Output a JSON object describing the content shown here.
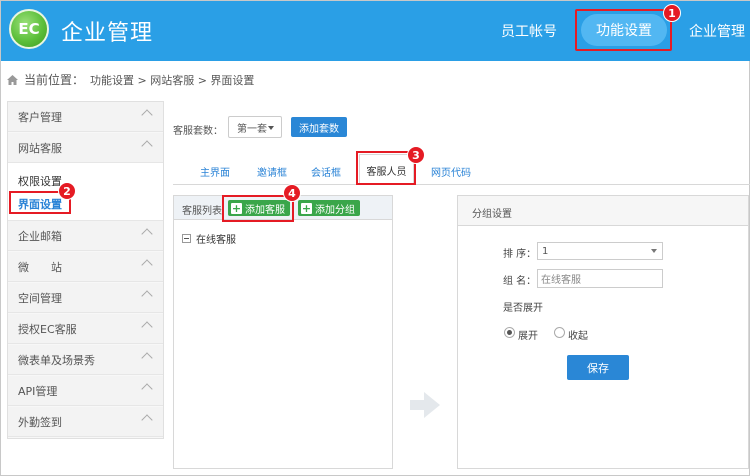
{
  "header": {
    "logo_text": "EC",
    "title": "企业管理",
    "nav": {
      "staff": "员工帐号",
      "function_settings": "功能设置",
      "enterprise": "企业管理"
    }
  },
  "breadcrumb": {
    "current_label": "当前位置：",
    "path": "功能设置 > 网站客服 > 界面设置"
  },
  "sidebar": {
    "items": [
      "客户管理",
      "网站客服",
      "企业邮箱",
      "微　　站",
      "空间管理",
      "授权EC客服",
      "微表单及场景秀",
      "API管理",
      "外勤签到"
    ],
    "sub_items": [
      "权限设置",
      "界面设置"
    ]
  },
  "toolbar": {
    "set_label": "客服套数：",
    "set_value": "第一套",
    "add_set_button": "添加套数"
  },
  "tabs": [
    "主界面",
    "邀请框",
    "会话框",
    "客服人员",
    "网页代码"
  ],
  "list_panel": {
    "title": "客服列表",
    "add_agent_button": "添加客服",
    "add_group_button": "添加分组",
    "tree_node": "在线客服"
  },
  "group_settings": {
    "title": "分组设置",
    "order_label": "排 序：",
    "order_value": "1",
    "name_label": "组 名：",
    "name_value": "在线客服",
    "expand_label": "是否展开",
    "radio_expand": "展开",
    "radio_collapse": "收起",
    "save_button": "保存"
  },
  "annotations": [
    "1",
    "2",
    "3",
    "4"
  ],
  "colors": {
    "header": "#2a9fe6",
    "accent": "#2a87d6",
    "green": "#3aa64a",
    "highlight_red": "#e51b24"
  }
}
